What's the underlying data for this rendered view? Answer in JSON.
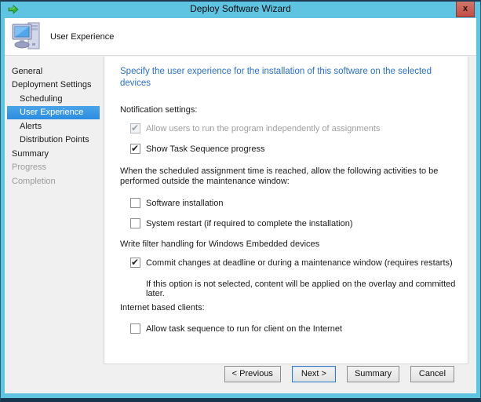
{
  "window": {
    "title": "Deploy Software Wizard",
    "close_label": "x"
  },
  "header": {
    "title": "User Experience"
  },
  "sidebar": {
    "items": [
      {
        "label": "General",
        "indent": 0,
        "state": "normal"
      },
      {
        "label": "Deployment Settings",
        "indent": 0,
        "state": "normal"
      },
      {
        "label": "Scheduling",
        "indent": 1,
        "state": "normal"
      },
      {
        "label": "User Experience",
        "indent": 1,
        "state": "selected"
      },
      {
        "label": "Alerts",
        "indent": 1,
        "state": "normal"
      },
      {
        "label": "Distribution Points",
        "indent": 1,
        "state": "normal"
      },
      {
        "label": "Summary",
        "indent": 0,
        "state": "normal"
      },
      {
        "label": "Progress",
        "indent": 0,
        "state": "disabled"
      },
      {
        "label": "Completion",
        "indent": 0,
        "state": "disabled"
      }
    ]
  },
  "content": {
    "heading": "Specify the user experience for the installation of this software on the selected devices",
    "notification": {
      "label": "Notification settings:",
      "checkboxes": [
        {
          "label": "Allow users to run the program independently of assignments",
          "checked": true,
          "enabled": false
        },
        {
          "label": "Show Task Sequence progress",
          "checked": true,
          "enabled": true
        }
      ]
    },
    "maintenance": {
      "label": "When the scheduled assignment time is reached, allow the following activities to be performed outside the maintenance window:",
      "checkboxes": [
        {
          "label": "Software installation",
          "checked": false,
          "enabled": true
        },
        {
          "label": "System restart (if required to complete the installation)",
          "checked": false,
          "enabled": true
        }
      ]
    },
    "write_filter": {
      "label": "Write filter handling for Windows Embedded devices",
      "checkboxes": [
        {
          "label": "Commit changes at deadline or during a maintenance window (requires restarts)",
          "checked": true,
          "enabled": true
        }
      ],
      "note": "If this option is not selected, content will be applied on the overlay and committed later."
    },
    "internet": {
      "label": "Internet based clients:",
      "checkboxes": [
        {
          "label": "Allow task sequence to run for client on the Internet",
          "checked": false,
          "enabled": true
        }
      ]
    }
  },
  "footer": {
    "buttons": [
      {
        "label": "< Previous",
        "default": false
      },
      {
        "label": "Next >",
        "default": true
      },
      {
        "label": "Summary",
        "default": false
      },
      {
        "label": "Cancel",
        "default": false
      }
    ]
  },
  "colors": {
    "titlebar_blue": "#5fc3e2",
    "selection_blue": "#3296e4",
    "heading_blue": "#2a70c6",
    "close_red": "#c14f46",
    "dialog_gray": "#f0f0f0",
    "panel_white": "#ffffff",
    "disabled_text": "#9b9b9b"
  }
}
